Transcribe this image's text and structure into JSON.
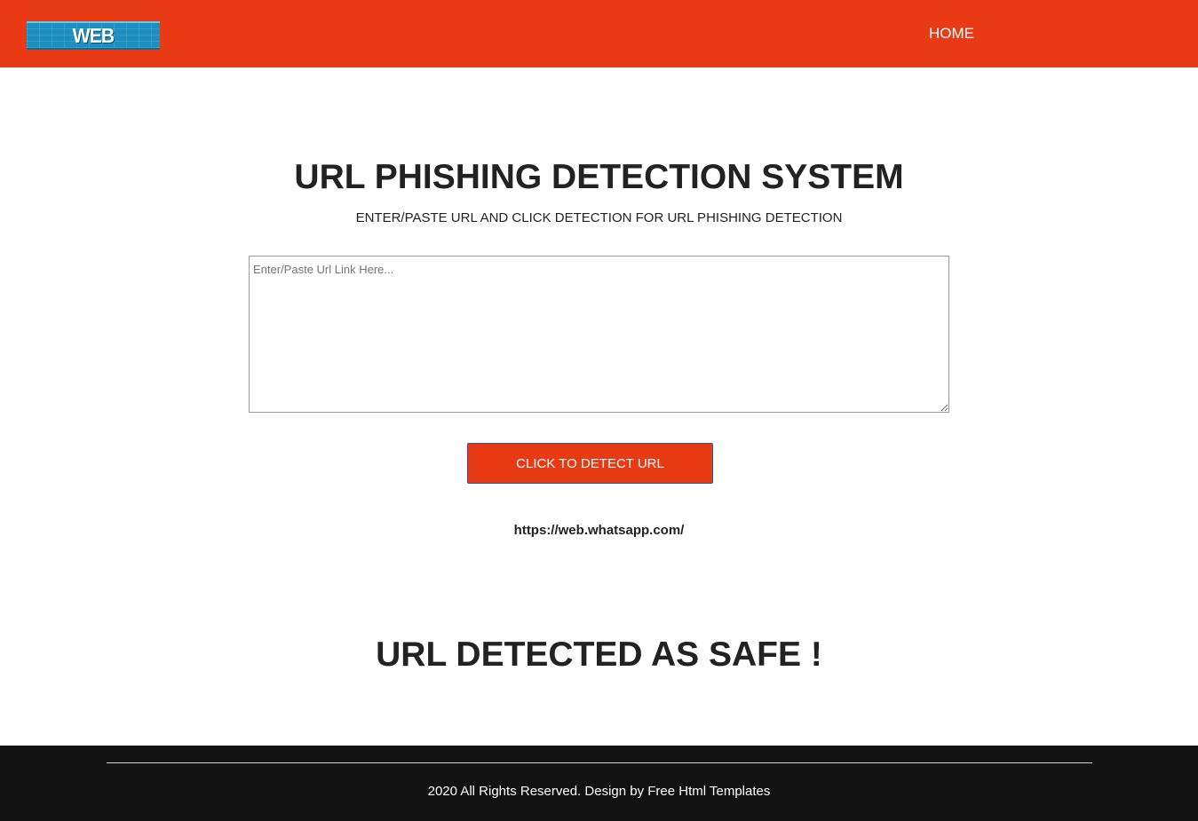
{
  "header": {
    "logo_text": "WEB DEFEND!",
    "nav": {
      "home_label": "HOME"
    }
  },
  "main": {
    "title": "URL PHISHING DETECTION SYSTEM",
    "subtitle": "ENTER/PASTE URL AND CLICK DETECTION FOR URL PHISHING DETECTION",
    "url_input": {
      "placeholder": "Enter/Paste Url Link Here...",
      "value": ""
    },
    "detect_button_label": "CLICK TO DETECT URL",
    "checked_url": "https://web.whatsapp.com/",
    "result_text": "URL DETECTED AS SAFE !"
  },
  "footer": {
    "copyright": "2020 All Rights Reserved. Design by Free Html Templates"
  },
  "colors": {
    "brand": "#e83a15",
    "footer_bg": "#121212",
    "logo_bg": "#1b8fc0"
  },
  "icons": {
    "logo": "brick-wall-logo"
  }
}
